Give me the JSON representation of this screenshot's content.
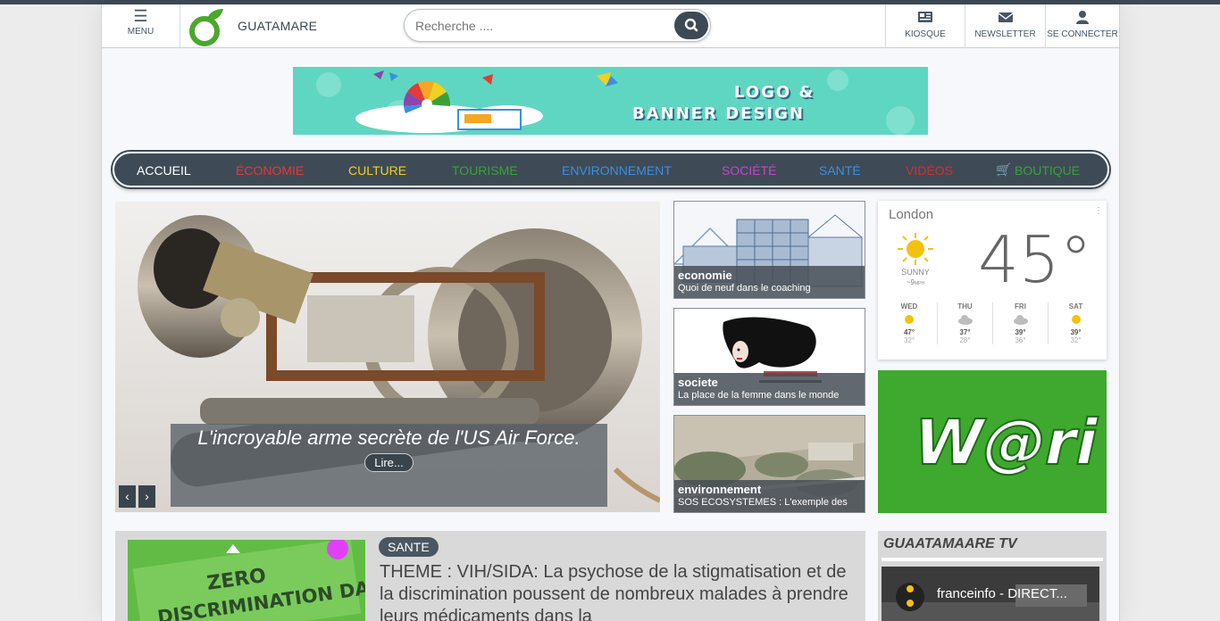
{
  "header": {
    "menu_label": "MENU",
    "brand": "GUATAMARE",
    "search_placeholder": "Recherche ....",
    "kiosque_label": "KIOSQUE",
    "newsletter_label": "NEWSLETTER",
    "login_label": "SE CONNECTER"
  },
  "banner": {
    "line1": "LOGO &",
    "line2": "BANNER DESIGN"
  },
  "nav": {
    "items": [
      {
        "label": "ACCUEIL",
        "color": "#ffffff"
      },
      {
        "label": "ÉCONOMIE",
        "color": "#e53935"
      },
      {
        "label": "CULTURE",
        "color": "#f0d020"
      },
      {
        "label": "TOURISME",
        "color": "#3aa13a"
      },
      {
        "label": "ENVIRONNEMENT",
        "color": "#3a8fe0"
      },
      {
        "label": "SOCIÉTÉ",
        "color": "#c347c9"
      },
      {
        "label": "SANTÉ",
        "color": "#3a8fe0"
      },
      {
        "label": "VIDÉOS",
        "color": "#d32f2f"
      },
      {
        "label": "BOUTIQUE",
        "color": "#3aa13a"
      }
    ]
  },
  "hero": {
    "title": "L'incroyable arme secrète de l'US Air Force.",
    "read_label": "Lire...",
    "prev_icon": "‹",
    "next_icon": "›"
  },
  "cards": [
    {
      "category": "economie",
      "subtitle": "Quoi de neuf dans le coaching"
    },
    {
      "category": "societe",
      "subtitle": "La place de la femme dans le monde"
    },
    {
      "category": "environnement",
      "subtitle": "SOS ECOSYSTEMES : L'exemple des"
    }
  ],
  "weather": {
    "city": "London",
    "temp": "45°",
    "condition": "SUNNY",
    "wind": "9",
    "wind_unit": "MPH",
    "forecast": [
      {
        "day": "WED",
        "hi": "47°",
        "lo": "32°",
        "icon": "sun-icon"
      },
      {
        "day": "THU",
        "hi": "37°",
        "lo": "28°",
        "icon": "cloud-icon"
      },
      {
        "day": "FRI",
        "hi": "39°",
        "lo": "36°",
        "icon": "cloud-icon"
      },
      {
        "day": "SAT",
        "hi": "39°",
        "lo": "32°",
        "icon": "sun-icon"
      }
    ]
  },
  "ad": {
    "text": "W@ri"
  },
  "article": {
    "tag": "SANTE",
    "title": "THEME : VIH/SIDA: La psychose de la stigmatisation et de la discrimination poussent de nombreux malades à prendre leurs médicaments dans la",
    "image_text_1": "ZERO",
    "image_text_2": "DISCRIMINATION DAY"
  },
  "tv": {
    "heading": "GUAATAMAARE TV",
    "video_title": "franceinfo - DIRECT..."
  },
  "colors": {
    "dark": "#3e4b57",
    "accent_green": "#3fa82e",
    "banner_teal": "#5fd6c1"
  }
}
